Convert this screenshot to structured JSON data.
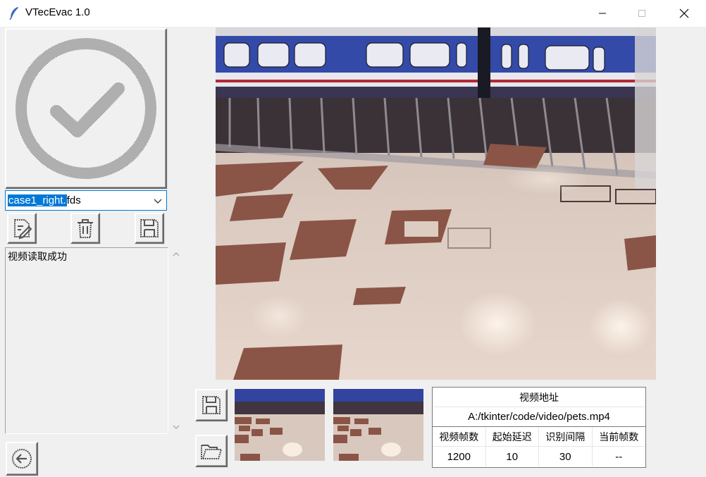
{
  "window": {
    "title": "VTecEvac 1.0",
    "app_icon": "feather-icon",
    "controls": [
      "minimize-icon",
      "maximize-icon",
      "close-icon"
    ]
  },
  "left_panel": {
    "status_icon": "checkmark-circle-icon",
    "case_select": {
      "selected_part": "case1_right.",
      "rest_part": "fds",
      "value": "case1_right.fds"
    },
    "action_icons": [
      "edit-icon",
      "trash-icon",
      "save-icon"
    ],
    "log_text": "视频读取成功",
    "back_icon": "back-arrow-icon"
  },
  "video_info": {
    "address_header": "视频地址",
    "address": "A:/tkinter/code/video/pets.mp4",
    "columns": [
      "视频帧数",
      "起始延迟",
      "识别间隔",
      "当前帧数"
    ],
    "values": [
      "1200",
      "10",
      "30",
      "--"
    ]
  },
  "colors": {
    "accent": "#0078d7",
    "background": "#f0f0f0"
  }
}
